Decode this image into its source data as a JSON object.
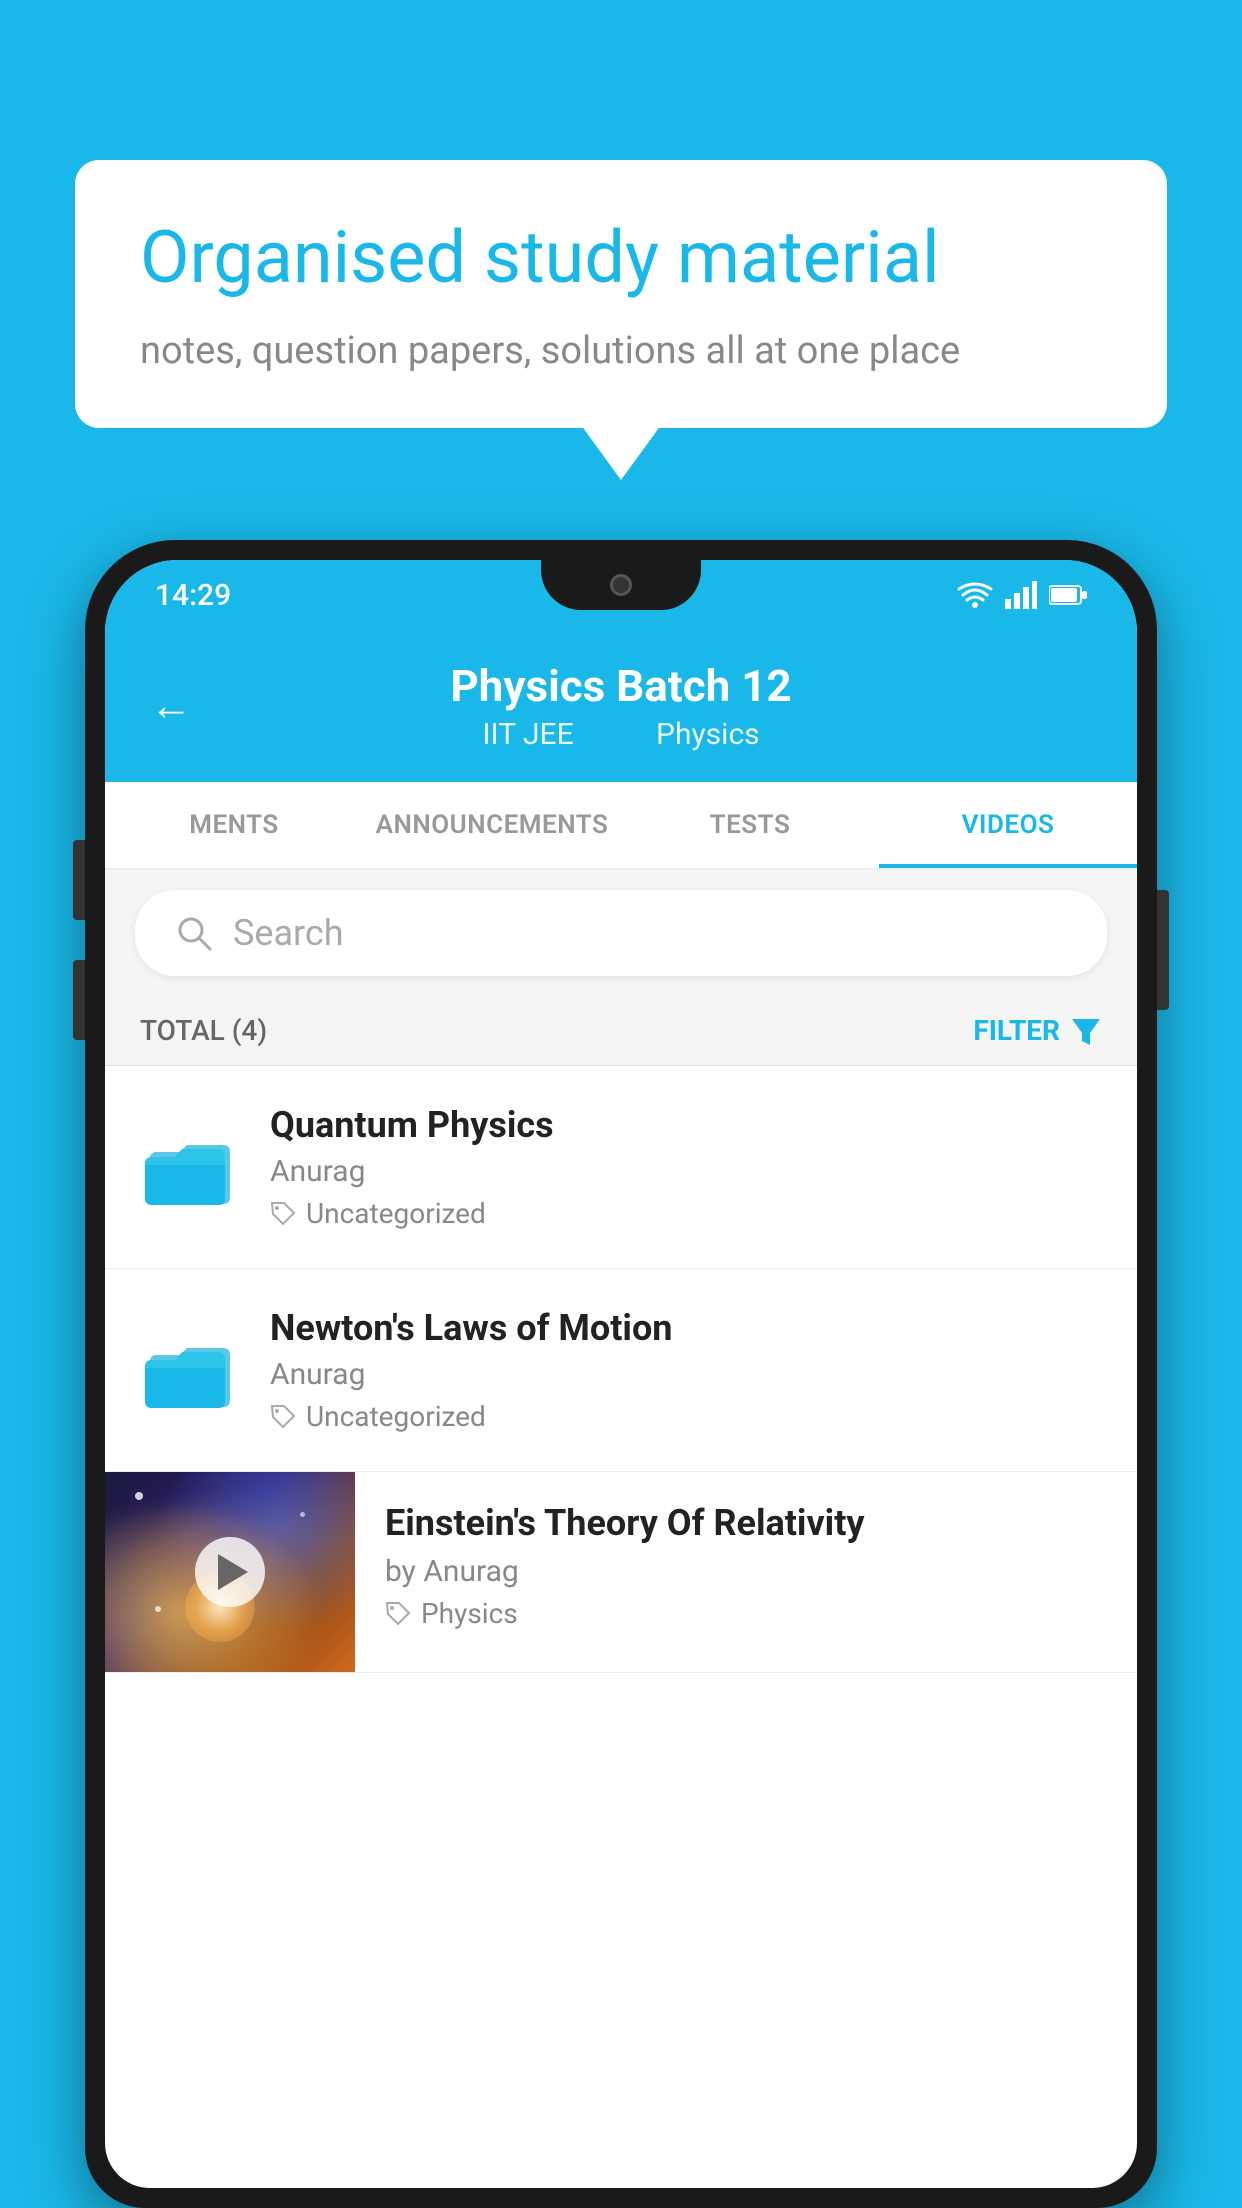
{
  "background_color": "#1ab8e8",
  "speech_bubble": {
    "title": "Organised study material",
    "subtitle": "notes, question papers, solutions all at one place"
  },
  "status_bar": {
    "time": "14:29",
    "wifi": "▾",
    "signal": "▴",
    "battery": "▮"
  },
  "app_header": {
    "back_icon": "←",
    "title": "Physics Batch 12",
    "subtitle_part1": "IIT JEE",
    "subtitle_part2": "Physics"
  },
  "tabs": [
    {
      "label": "MENTS",
      "active": false
    },
    {
      "label": "ANNOUNCEMENTS",
      "active": false
    },
    {
      "label": "TESTS",
      "active": false
    },
    {
      "label": "VIDEOS",
      "active": true
    }
  ],
  "search": {
    "placeholder": "Search"
  },
  "filter_row": {
    "total_label": "TOTAL (4)",
    "filter_label": "FILTER"
  },
  "videos": [
    {
      "id": 1,
      "title": "Quantum Physics",
      "author": "Anurag",
      "tag": "Uncategorized",
      "type": "folder"
    },
    {
      "id": 2,
      "title": "Newton's Laws of Motion",
      "author": "Anurag",
      "tag": "Uncategorized",
      "type": "folder"
    },
    {
      "id": 3,
      "title": "Einstein's Theory Of Relativity",
      "author": "by Anurag",
      "tag": "Physics",
      "type": "video"
    }
  ]
}
